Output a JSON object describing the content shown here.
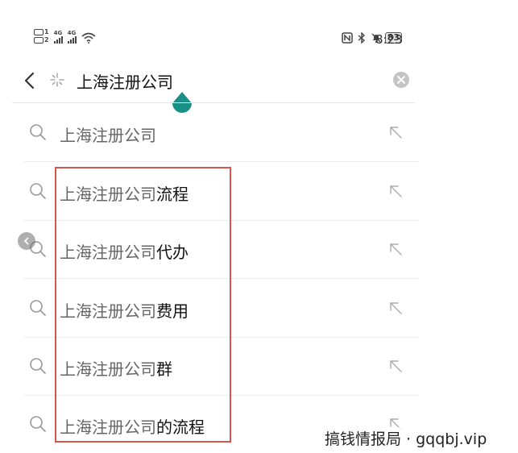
{
  "status_bar": {
    "sim_numbers": [
      "1",
      "2"
    ],
    "network_tags": [
      "4G",
      "4G"
    ],
    "battery": "83",
    "time": "8:23"
  },
  "search": {
    "query": "上海注册公司",
    "icons": {
      "back": "chevron-left-icon",
      "spark": "spark-icon",
      "clear": "clear-icon"
    }
  },
  "suggestions": [
    {
      "prefix": "上海注册公司",
      "suffix": ""
    },
    {
      "prefix": "上海注册公司",
      "suffix": "流程"
    },
    {
      "prefix": "上海注册公司",
      "suffix": "代办"
    },
    {
      "prefix": "上海注册公司",
      "suffix": "费用"
    },
    {
      "prefix": "上海注册公司",
      "suffix": "群"
    },
    {
      "prefix": "上海注册公司",
      "suffix": "的流程"
    }
  ],
  "colors": {
    "accent_handle": "#1a8f86",
    "highlight_border": "#d9534f"
  },
  "watermark": "搞钱情报局 · gqqbj.vip"
}
